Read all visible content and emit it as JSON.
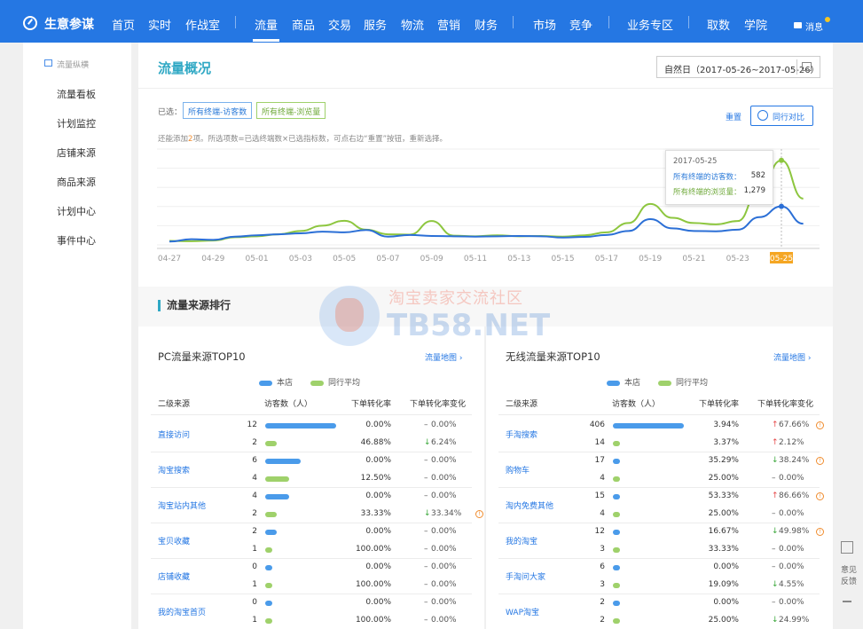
{
  "topnav": {
    "brand": "生意参谋",
    "items": [
      "首页",
      "实时",
      "作战室",
      "流量",
      "商品",
      "交易",
      "服务",
      "物流",
      "营销",
      "财务",
      "市场",
      "竞争",
      "业务专区",
      "取数",
      "学院"
    ],
    "active": "流量",
    "message": "消息"
  },
  "sidebar": {
    "header": "流量纵横",
    "items": [
      "流量看板",
      "计划监控",
      "店铺来源",
      "商品来源",
      "计划中心",
      "事件中心"
    ]
  },
  "overview": {
    "title": "流量概况",
    "date_range": "自然日（2017-05-26~2017-05-26）",
    "selected_label": "已选：",
    "tags": [
      "所有终端-访客数",
      "所有终端-浏览量"
    ],
    "reset": "重置",
    "compare": "同行对比",
    "hint_pre": "还能添加",
    "hint_num": "2",
    "hint_post": "项。所选项数=已选终端数×已选指标数，可点右边“重置”按钮，重新选择。",
    "tooltip": {
      "date": "2017-05-25",
      "rows": [
        {
          "label": "所有终端的访客数：",
          "value": "582"
        },
        {
          "label": "所有终端的浏览量：",
          "value": "1,279"
        }
      ]
    }
  },
  "chart_data": {
    "type": "line",
    "x": [
      "04-27",
      "04-28",
      "04-29",
      "04-30",
      "05-01",
      "05-02",
      "05-03",
      "05-04",
      "05-05",
      "05-06",
      "05-07",
      "05-08",
      "05-09",
      "05-10",
      "05-11",
      "05-12",
      "05-13",
      "05-14",
      "05-15",
      "05-16",
      "05-17",
      "05-18",
      "05-19",
      "05-20",
      "05-21",
      "05-22",
      "05-23",
      "05-24",
      "05-25",
      "05-26"
    ],
    "tick_labels": [
      "04-27",
      "04-29",
      "05-01",
      "05-03",
      "05-05",
      "05-07",
      "05-09",
      "05-11",
      "05-13",
      "05-15",
      "05-17",
      "05-19",
      "05-21",
      "05-23",
      "05-25"
    ],
    "highlight": "05-25",
    "series": [
      {
        "name": "所有终端的访客数",
        "color": "#2b6fd6",
        "values": [
          50,
          85,
          75,
          125,
          145,
          160,
          175,
          200,
          190,
          225,
          125,
          150,
          135,
          130,
          125,
          130,
          135,
          130,
          110,
          120,
          150,
          210,
          390,
          250,
          210,
          205,
          230,
          420,
          582,
          320
        ]
      },
      {
        "name": "所有终端的浏览量",
        "color": "#8dc63f",
        "values": [
          60,
          55,
          65,
          115,
          130,
          160,
          210,
          290,
          365,
          230,
          160,
          155,
          360,
          140,
          130,
          145,
          130,
          135,
          125,
          145,
          190,
          330,
          620,
          410,
          330,
          310,
          360,
          850,
          1279,
          700
        ]
      }
    ],
    "ylim": [
      0,
      1450
    ],
    "grid": true
  },
  "sources": {
    "title": "流量来源排行",
    "pc": {
      "title": "PC流量来源TOP10",
      "link": "流量地图 ›",
      "legend": [
        "本店",
        "同行平均"
      ],
      "columns": [
        "二级来源",
        "访客数（人）",
        "下单转化率",
        "下单转化率变化"
      ],
      "max": 12,
      "rows": [
        {
          "name": "直接访问",
          "store": {
            "v": 12,
            "rate": "0.00%",
            "chg": "0.00%",
            "dir": "flat"
          },
          "peer": {
            "v": 2,
            "rate": "46.88%",
            "chg": "6.24%",
            "dir": "down"
          }
        },
        {
          "name": "淘宝搜索",
          "store": {
            "v": 6,
            "rate": "0.00%",
            "chg": "0.00%",
            "dir": "flat"
          },
          "peer": {
            "v": 4,
            "rate": "12.50%",
            "chg": "0.00%",
            "dir": "flat"
          }
        },
        {
          "name": "淘宝站内其他",
          "store": {
            "v": 4,
            "rate": "0.00%",
            "chg": "0.00%",
            "dir": "flat"
          },
          "peer": {
            "v": 2,
            "rate": "33.33%",
            "chg": "33.34%",
            "dir": "down",
            "warn": true
          }
        },
        {
          "name": "宝贝收藏",
          "store": {
            "v": 2,
            "rate": "0.00%",
            "chg": "0.00%",
            "dir": "flat"
          },
          "peer": {
            "v": 1,
            "rate": "100.00%",
            "chg": "0.00%",
            "dir": "flat"
          }
        },
        {
          "name": "店铺收藏",
          "store": {
            "v": 0,
            "rate": "0.00%",
            "chg": "0.00%",
            "dir": "flat"
          },
          "peer": {
            "v": 1,
            "rate": "100.00%",
            "chg": "0.00%",
            "dir": "flat"
          }
        },
        {
          "name": "我的淘宝首页",
          "store": {
            "v": 0,
            "rate": "0.00%",
            "chg": "0.00%",
            "dir": "flat"
          },
          "peer": {
            "v": 1,
            "rate": "100.00%",
            "chg": "0.00%",
            "dir": "flat"
          }
        }
      ]
    },
    "mobile": {
      "title": "无线流量来源TOP10",
      "link": "流量地图 ›",
      "legend": [
        "本店",
        "同行平均"
      ],
      "columns": [
        "二级来源",
        "访客数（人）",
        "下单转化率",
        "下单转化率变化"
      ],
      "max": 406,
      "rows": [
        {
          "name": "手淘搜索",
          "store": {
            "v": 406,
            "rate": "3.94%",
            "chg": "67.66%",
            "dir": "up",
            "warn": true
          },
          "peer": {
            "v": 14,
            "rate": "3.37%",
            "chg": "2.12%",
            "dir": "up"
          }
        },
        {
          "name": "购物车",
          "store": {
            "v": 17,
            "rate": "35.29%",
            "chg": "38.24%",
            "dir": "down",
            "warn": true
          },
          "peer": {
            "v": 4,
            "rate": "25.00%",
            "chg": "0.00%",
            "dir": "flat"
          }
        },
        {
          "name": "淘内免费其他",
          "store": {
            "v": 15,
            "rate": "53.33%",
            "chg": "86.66%",
            "dir": "up",
            "warn": true
          },
          "peer": {
            "v": 4,
            "rate": "25.00%",
            "chg": "0.00%",
            "dir": "flat"
          }
        },
        {
          "name": "我的淘宝",
          "store": {
            "v": 12,
            "rate": "16.67%",
            "chg": "49.98%",
            "dir": "down",
            "warn": true
          },
          "peer": {
            "v": 3,
            "rate": "33.33%",
            "chg": "0.00%",
            "dir": "flat"
          }
        },
        {
          "name": "手淘问大家",
          "store": {
            "v": 6,
            "rate": "0.00%",
            "chg": "0.00%",
            "dir": "flat"
          },
          "peer": {
            "v": 3,
            "rate": "19.09%",
            "chg": "4.55%",
            "dir": "down"
          }
        },
        {
          "name": "WAP淘宝",
          "store": {
            "v": 2,
            "rate": "0.00%",
            "chg": "0.00%",
            "dir": "flat"
          },
          "peer": {
            "v": 2,
            "rate": "25.00%",
            "chg": "24.99%",
            "dir": "down"
          }
        }
      ]
    }
  },
  "float": {
    "feedback": "意见反馈"
  },
  "watermark": {
    "cn": "淘宝卖家交流社区",
    "en": "TB58.NET"
  },
  "colors": {
    "nav": "#2577e3",
    "store_bar": "#4a9bea",
    "peer_bar": "#9fd16b",
    "accent": "#2fa8c4"
  }
}
